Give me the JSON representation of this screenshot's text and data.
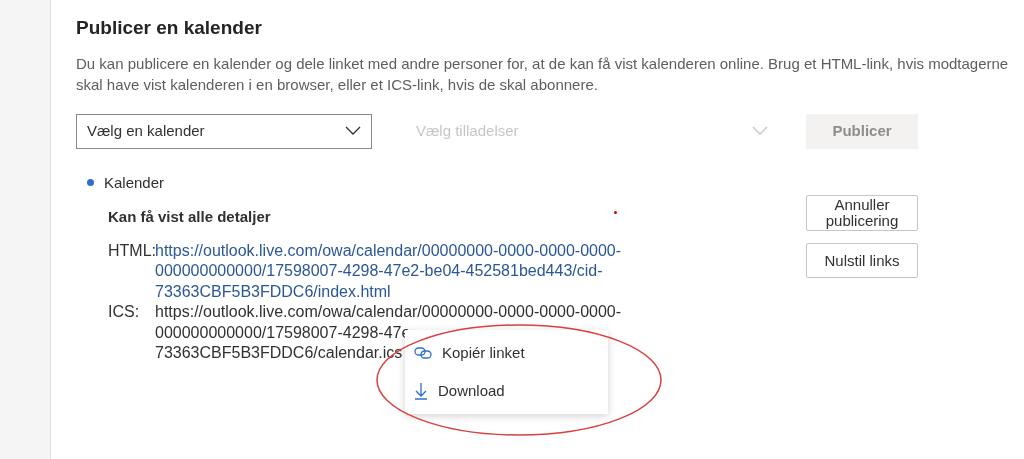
{
  "title": "Publicer en kalender",
  "description": "Du kan publicere en kalender og dele linket med andre personer for, at de kan få vist kalenderen online. Brug et HTML-link, hvis modtagerne skal have vist kalenderen i en browser, eller et ICS-link, hvis de skal abonnere.",
  "calendar_dropdown": {
    "placeholder": "Vælg en kalender",
    "disabled": false
  },
  "permissions_dropdown": {
    "placeholder": "Vælg tilladelser",
    "disabled": true
  },
  "publish_button": {
    "label": "Publicer",
    "disabled": true
  },
  "calendar": {
    "name": "Kalender",
    "color": "#2f6fce",
    "permission": "Kan få vist alle detaljer",
    "links": [
      {
        "label": "HTML:",
        "kind": "link",
        "lines": [
          "https://outlook.live.com/owa/calendar/00000000-0000-0000-0000-",
          "000000000000/17598007-4298-47e2-be04-452581bed443/cid-",
          "73363CBF5B3FDDC6/index.html"
        ]
      },
      {
        "label": "ICS:",
        "kind": "plain",
        "lines": [
          "https://outlook.live.com/owa/calendar/00000000-0000-0000-0000-",
          "000000000000/17598007-4298-47e",
          "73363CBF5B3FDDC6/calendar.ics"
        ]
      }
    ],
    "buttons": [
      "Annuller publicering",
      "Nulstil links"
    ]
  },
  "context_menu": [
    {
      "label": "Kopiér linket",
      "kind": "copy"
    },
    {
      "label": "Download",
      "kind": "download"
    }
  ]
}
